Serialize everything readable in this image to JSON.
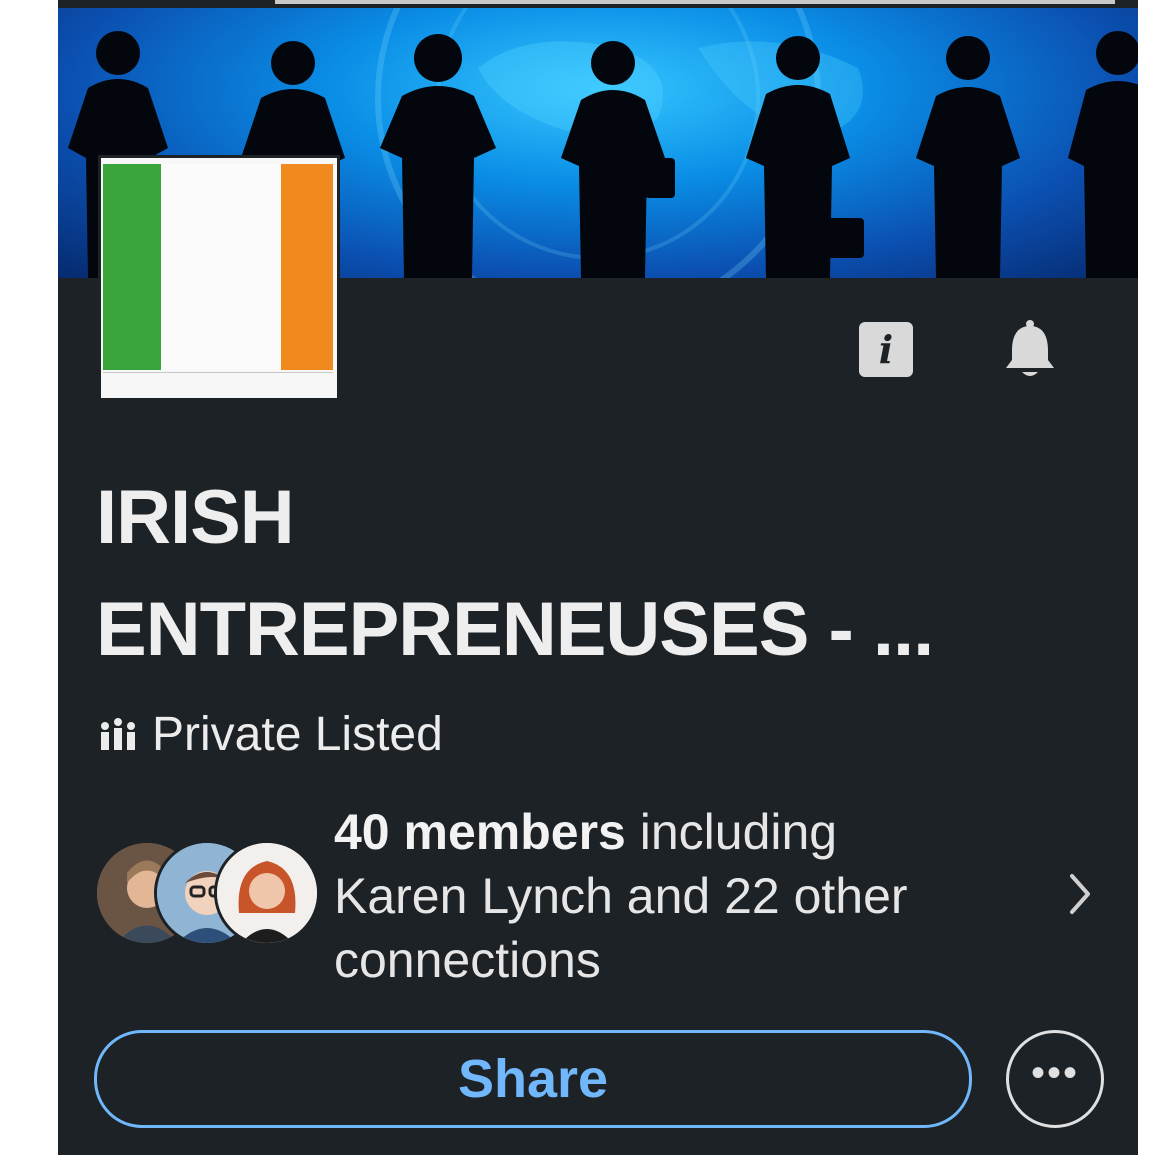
{
  "group": {
    "name_line1": "IRISH",
    "name_line2": "ENTREPRENEUSES - ...",
    "privacy_label": "Private Listed",
    "members_count_text": "40 members",
    "members_including": " including",
    "members_connections_text": "Karen Lynch and 22 other connections"
  },
  "actions": {
    "share_label": "Share",
    "more_label": "•••"
  },
  "icons": [
    "info-icon",
    "bell-icon",
    "group-privacy-icon",
    "chevron-right-icon",
    "more-options-icon"
  ],
  "colors": {
    "background": "#1d2226",
    "accent": "#71b7fb",
    "flag_green": "#3aa53a",
    "flag_orange": "#f08a1f"
  }
}
